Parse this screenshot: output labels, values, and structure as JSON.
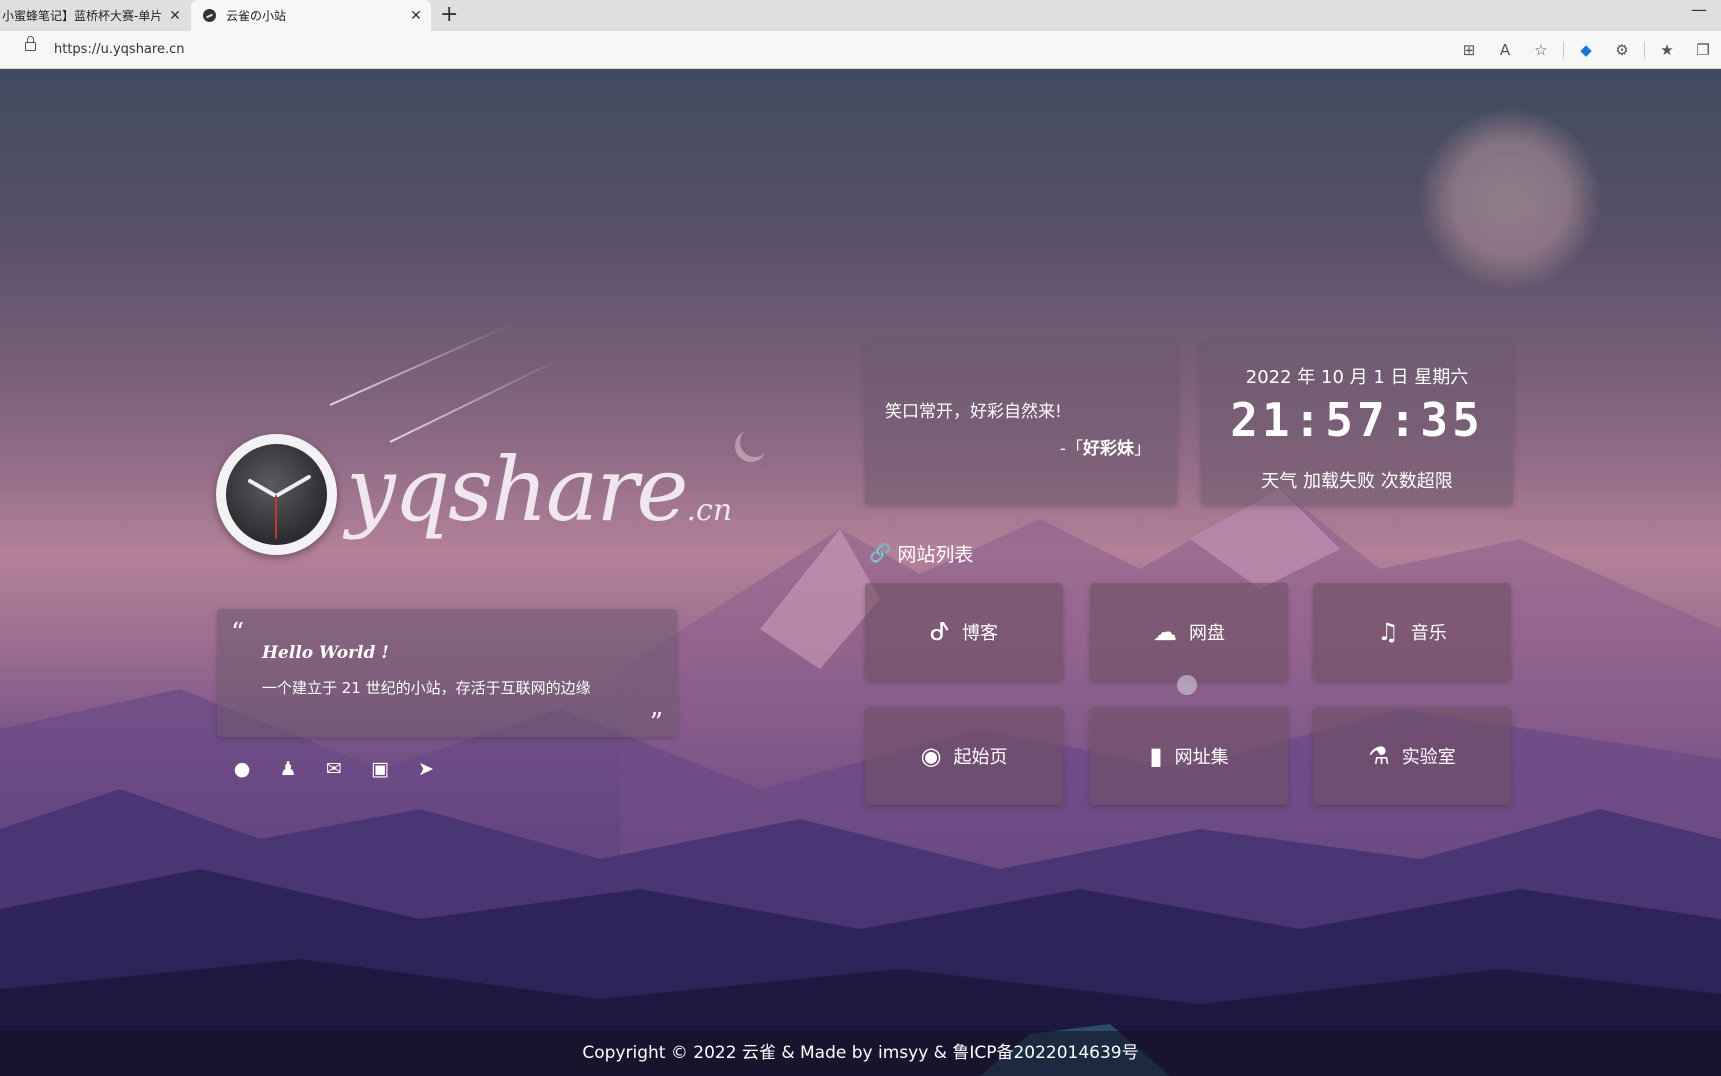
{
  "browser": {
    "tabs": [
      {
        "label": "小蜜蜂笔记】蓝桥杯大赛-单片"
      },
      {
        "label": "云雀の小站"
      }
    ],
    "url": "https://u.yqshare.cn"
  },
  "logo": {
    "main": "yqshare",
    "suffix": ".cn"
  },
  "hello": {
    "title": "Hello World !",
    "desc": "一个建立于 21 世纪的小站，存活于互联网的边缘",
    "open_quote": "“",
    "close_quote": "”"
  },
  "hitokoto": {
    "text": "笑口常开，好彩自然来!",
    "from_prefix": "-「",
    "from_name": "好彩妹",
    "from_suffix": "」"
  },
  "time": {
    "date": "2022 年 10 月 1 日 星期六",
    "clock": "21:57:35",
    "weather": "天气 加载失败 次数超限"
  },
  "site_list": {
    "title": "网站列表"
  },
  "sites": [
    {
      "label": "博客",
      "icon": "blog-icon"
    },
    {
      "label": "网盘",
      "icon": "cloud-icon"
    },
    {
      "label": "音乐",
      "icon": "music-icon"
    },
    {
      "label": "起始页",
      "icon": "compass-icon"
    },
    {
      "label": "网址集",
      "icon": "bookmark-icon"
    },
    {
      "label": "实验室",
      "icon": "flask-icon"
    }
  ],
  "socials": [
    "github-icon",
    "qq-icon",
    "mail-icon",
    "bilibili-icon",
    "telegram-icon"
  ],
  "footer": {
    "text": "Copyright © 2022 云雀 & Made by imsyy & 鲁ICP备2022014639号"
  }
}
